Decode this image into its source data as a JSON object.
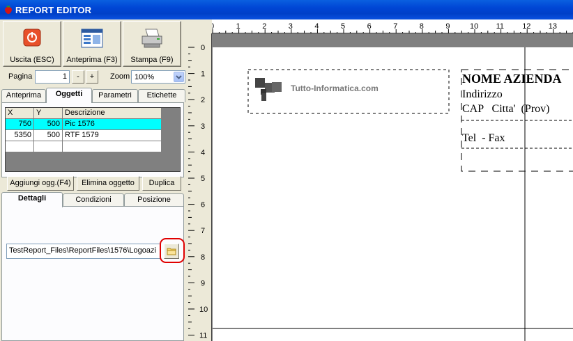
{
  "window": {
    "title": "REPORT EDITOR"
  },
  "toolbar": {
    "exit_label": "Uscita (ESC)",
    "preview_label": "Anteprima (F3)",
    "print_label": "Stampa (F9)"
  },
  "paging": {
    "page_label": "Pagina",
    "page_value": "1",
    "minus_label": "-",
    "plus_label": "+",
    "zoom_label": "Zoom",
    "zoom_value": "100%"
  },
  "tabs_top": [
    "Anteprima",
    "Oggetti",
    "Parametri",
    "Etichette"
  ],
  "objects_grid": {
    "headers": [
      "X",
      "Y",
      "Descrizione"
    ],
    "rows": [
      {
        "x": "750",
        "y": "500",
        "desc": "Pic 1576"
      },
      {
        "x": "5350",
        "y": "500",
        "desc": "RTF 1579"
      }
    ]
  },
  "actions": {
    "add_label": "Aggiungi ogg.(F4)",
    "delete_label": "Elimina oggetto",
    "duplicate_label": "Duplica"
  },
  "tabs_bottom": [
    "Dettagli",
    "Condizioni",
    "Posizione"
  ],
  "details": {
    "file_path": "TestReport_Files\\ReportFiles\\1576\\Logoazi"
  },
  "ruler": {
    "horizontal": [
      "0",
      "1",
      "2",
      "3",
      "4",
      "5",
      "6",
      "7",
      "8",
      "9",
      "10",
      "11",
      "12",
      "13"
    ],
    "vertical": [
      "0",
      "1",
      "2",
      "3",
      "4",
      "5",
      "6",
      "7",
      "8",
      "9",
      "10",
      "11"
    ]
  },
  "report": {
    "logo_text": "Tutto-Informatica.com",
    "company_name": "NOME AZIENDA",
    "address": "Indirizzo",
    "city_line": "CAP   Citta'  (Prov)",
    "phone_line": "Tel  - Fax"
  },
  "colors": {
    "selected_row": "#00ffff",
    "highlight": "#e00000",
    "titlebar": "#0046d5"
  }
}
